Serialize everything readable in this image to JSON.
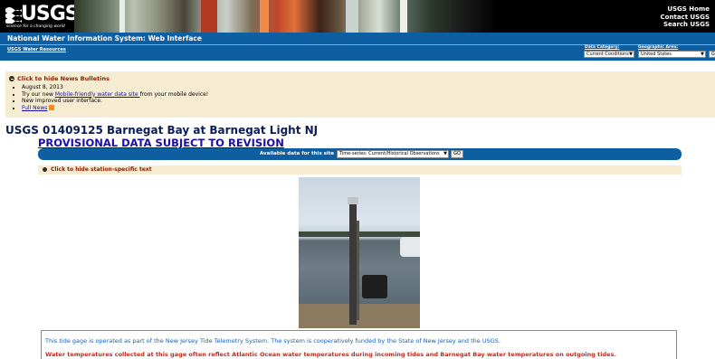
{
  "banner": {
    "logo_text": "USGS",
    "tagline": "science for a changing world",
    "links": [
      "USGS Home",
      "Contact USGS",
      "Search USGS"
    ]
  },
  "nav": {
    "title": "National Water Information System: Web Interface",
    "resources_link": "USGS Water Resources",
    "data_category_label": "Data Category:",
    "data_category_value": "Current Conditions",
    "geographic_area_label": "Geographic Area:",
    "geographic_area_value": "United States",
    "go_label": "G"
  },
  "news": {
    "header": "Click to hide News Bulletins",
    "items": [
      "August 8, 2013",
      "Try our new ",
      "Mobile-friendly water data site ",
      "from your mobile device!",
      "New improved user interface.",
      "Full News"
    ]
  },
  "site": {
    "title": "USGS 01409125 Barnegat Bay at Barnegat Light NJ",
    "provisional": "PROVISIONAL DATA SUBJECT TO REVISION"
  },
  "available": {
    "label": "Available data for this site",
    "select_value": "Time-series:   Current/Historical Observations",
    "go_label": "GO"
  },
  "station": {
    "header": "Click to hide station-specific text",
    "text1": "This tide gage is operated as part of the New Jersey Tide Telemetry System. The system is cooperatively funded by the State of New Jersey and the USGS.",
    "text2": "Water temperatures collected at this gage often reflect Atlantic Ocean water temperatures during incoming tides and Barnegat Bay water temperatures on outgoing tides."
  },
  "colors": {
    "nav_blue": "#0e5fa1",
    "news_bg": "#f6ecd2",
    "header_red": "#8a1d00",
    "link_blue": "#1a0dab",
    "warning_red": "#c8281a"
  }
}
